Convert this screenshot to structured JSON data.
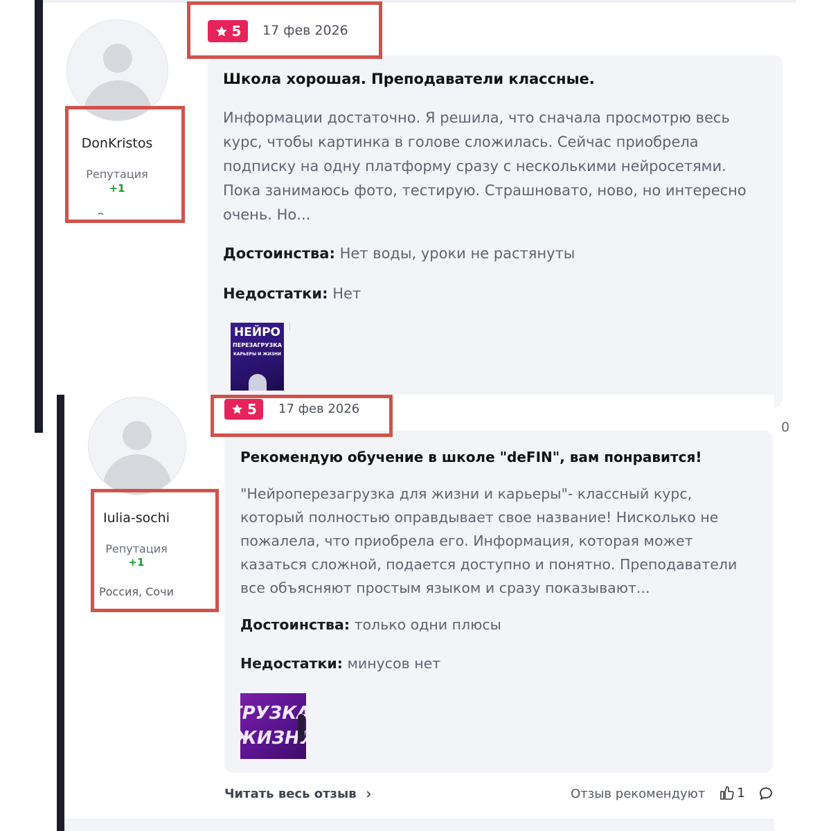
{
  "reviews": [
    {
      "username": "DonKristos",
      "reputation_label": "Репутация",
      "reputation_value": "+1",
      "location": "Россия",
      "rating": "5",
      "date": "17 фев 2026",
      "title": "Школа хорошая. Преподаватели классные.",
      "body": "Информации достаточно. Я решила, что сначала просмотрю весь курс, чтобы картинка в голове сложилась. Сейчас приобрела подписку на одну платформу сразу с несколькими нейросетями. Пока занимаюсь фото, тестирую. Страшновато, ново, но интересно очень. Но...",
      "pros_label": "Достоинства:",
      "pros": "Нет воды, уроки не растянуты",
      "cons_label": "Недостатки:",
      "cons": "Нет",
      "image_text": [
        "НЕЙРО",
        "ПЕРЕЗАГРУЗКА",
        "КАРЬЕРЫ И ЖИЗНИ"
      ],
      "side_count": "0"
    },
    {
      "username": "Iulia-sochi",
      "reputation_label": "Репутация",
      "reputation_value": "+1",
      "location": "Россия, Сочи",
      "rating": "5",
      "date": "17 фев 2026",
      "title": "Рекомендую обучение в школе \"deFIN\", вам понравится!",
      "body": "\"Нейроперезагрузка для жизни и карьеры\"- классный курс, который полностью оправдывает свое название! Нисколько не пожалела, что приобрела его. Информация, которая может казаться сложной, подается доступно и понятно. Преподаватели все объясняют простым языком и сразу показывают...",
      "pros_label": "Достоинства:",
      "pros": "только одни плюсы",
      "cons_label": "Недостатки:",
      "cons": "минусов нет",
      "image_text": [
        "ГРУЗКА",
        "ЖИЗНИ"
      ],
      "read_more": "Читать весь отзыв",
      "recommend_label": "Отзыв рекомендуют",
      "likes": "1"
    }
  ],
  "colors": {
    "rating_badge": "#e6235a",
    "highlight": "#d1524a",
    "reputation": "#1a9f2d",
    "card": "#f3f4f7"
  },
  "icons": [
    "user-avatar-icon",
    "star-icon",
    "chevron-right-icon",
    "thumbs-up-icon",
    "comment-icon"
  ]
}
